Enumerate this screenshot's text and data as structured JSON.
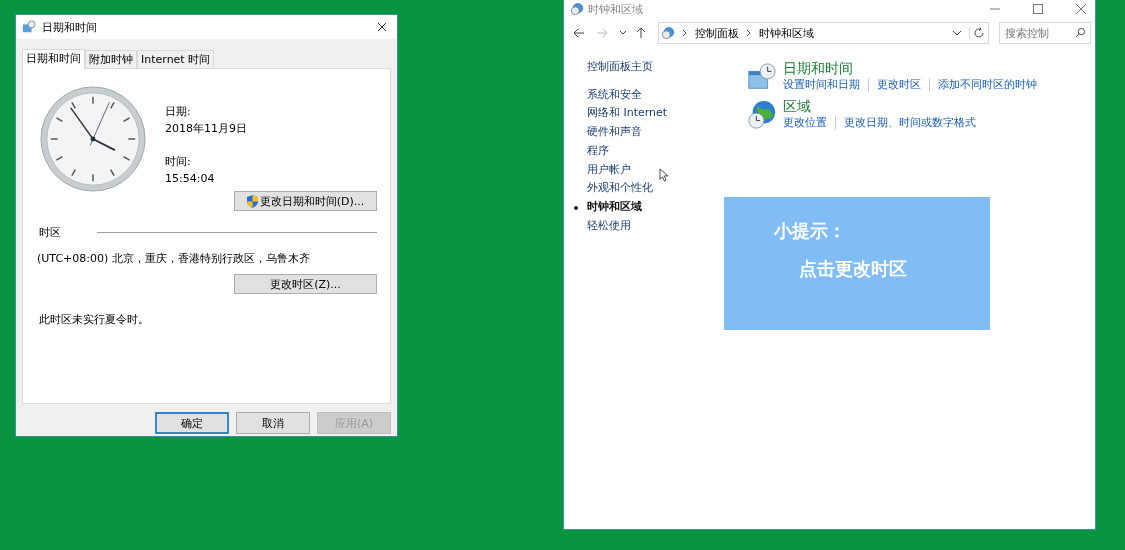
{
  "dialog": {
    "title": "日期和时间",
    "tabs": [
      {
        "label": "日期和时间",
        "selected": true
      },
      {
        "label": "附加时钟",
        "selected": false
      },
      {
        "label": "Internet 时间",
        "selected": false
      }
    ],
    "date_label": "日期:",
    "date": "2018年11月9日",
    "time_label": "时间:",
    "time": "15:54:04",
    "change_datetime_button": "更改日期和时间(D)...",
    "timezone_heading": "时区",
    "timezone": "(UTC+08:00) 北京，重庆，香港特别行政区，乌鲁木齐",
    "change_timezone_button": "更改时区(Z)...",
    "dst_note": "此时区未实行夏令时。",
    "buttons": [
      {
        "label": "确定",
        "default": true,
        "disabled": false
      },
      {
        "label": "取消",
        "default": false,
        "disabled": false
      },
      {
        "label": "应用(A)",
        "default": false,
        "disabled": true
      }
    ]
  },
  "control_panel": {
    "title": "时钟和区域",
    "breadcrumb": [
      "控制面板",
      "时钟和区域"
    ],
    "search": {
      "placeholder": "搜索控制"
    },
    "sidebar": {
      "home": "控制面板主页",
      "items": [
        {
          "label": "系统和安全",
          "selected": false
        },
        {
          "label": "网络和 Internet",
          "selected": false
        },
        {
          "label": "硬件和声音",
          "selected": false
        },
        {
          "label": "程序",
          "selected": false
        },
        {
          "label": "用户帐户",
          "selected": false
        },
        {
          "label": "外观和个性化",
          "selected": false
        },
        {
          "label": "时钟和区域",
          "selected": true
        },
        {
          "label": "轻松使用",
          "selected": false
        }
      ]
    },
    "categories": [
      {
        "kind": "datetime",
        "title": "日期和时间",
        "links": [
          "设置时间和日期",
          "更改时区",
          "添加不同时区的时钟"
        ]
      },
      {
        "kind": "region",
        "title": "区域",
        "links": [
          "更改位置",
          "更改日期、时间或数字格式"
        ]
      }
    ]
  },
  "tip": {
    "title": "小提示：",
    "text": "点击更改时区"
  }
}
